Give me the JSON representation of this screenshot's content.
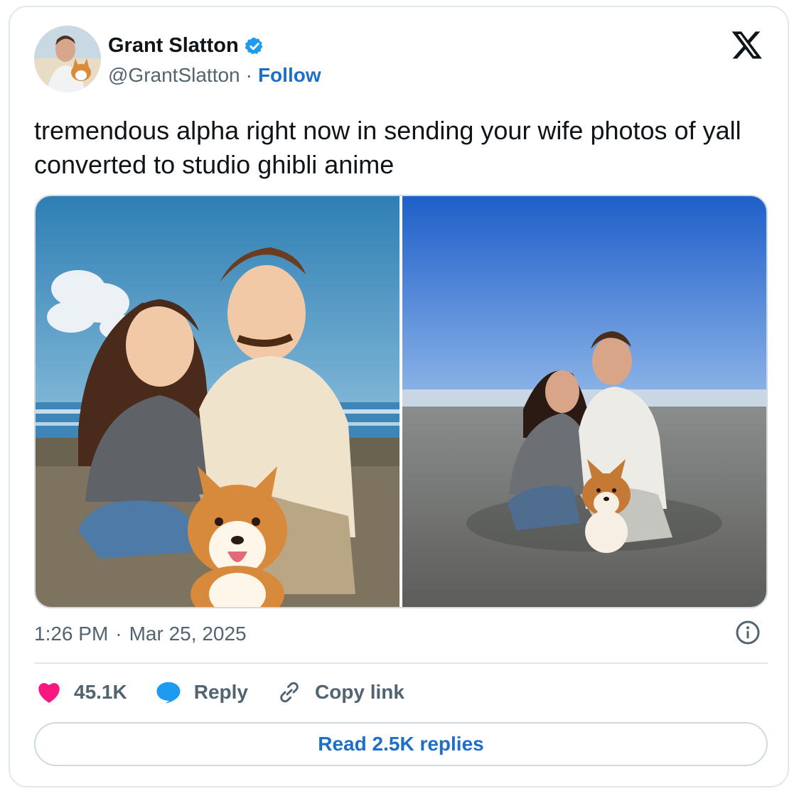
{
  "author": {
    "name": "Grant Slatton",
    "handle": "@GrantSlatton",
    "separator": "·",
    "follow_label": "Follow",
    "verified_icon": "verified-badge-icon"
  },
  "tweet": {
    "text": "tremendous alpha right now in sending your wife photos of yall converted to studio ghibli anime",
    "time": "1:26 PM",
    "date_separator": "·",
    "date": "Mar 25, 2025"
  },
  "media": [
    {
      "name": "ghibli-anime-photo",
      "kind": "illustration"
    },
    {
      "name": "original-beach-photo",
      "kind": "photo"
    }
  ],
  "actions": {
    "likes": "45.1K",
    "reply_label": "Reply",
    "copy_link_label": "Copy link"
  },
  "read_replies_label": "Read 2.5K replies",
  "colors": {
    "accent": "#1d6fc9",
    "like": "#f91880",
    "verified": "#1d9bf0",
    "muted": "#536471",
    "border": "#cfd9de"
  }
}
